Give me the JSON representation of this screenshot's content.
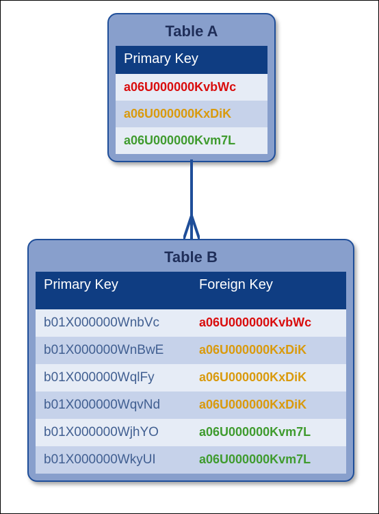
{
  "tableA": {
    "title": "Table A",
    "columns": [
      "Primary Key"
    ],
    "rows": [
      {
        "pk": "a06U000000KvbWc",
        "color": "c-red"
      },
      {
        "pk": "a06U000000KxDiK",
        "color": "c-gold"
      },
      {
        "pk": "a06U000000Kvm7L",
        "color": "c-green"
      }
    ]
  },
  "tableB": {
    "title": "Table B",
    "columns": [
      "Primary Key",
      "Foreign Key"
    ],
    "rows": [
      {
        "pk": "b01X000000WnbVc",
        "fk": "a06U000000KvbWc",
        "fkColor": "c-red"
      },
      {
        "pk": "b01X000000WnBwE",
        "fk": "a06U000000KxDiK",
        "fkColor": "c-gold"
      },
      {
        "pk": "b01X000000WqlFy",
        "fk": "a06U000000KxDiK",
        "fkColor": "c-gold"
      },
      {
        "pk": "b01X000000WqvNd",
        "fk": "a06U000000KxDiK",
        "fkColor": "c-gold"
      },
      {
        "pk": "b01X000000WjhYO",
        "fk": "a06U000000Kvm7L",
        "fkColor": "c-green"
      },
      {
        "pk": "b01X000000WkyUI",
        "fk": "a06U000000Kvm7L",
        "fkColor": "c-green"
      }
    ]
  },
  "relationship": "one-to-many"
}
